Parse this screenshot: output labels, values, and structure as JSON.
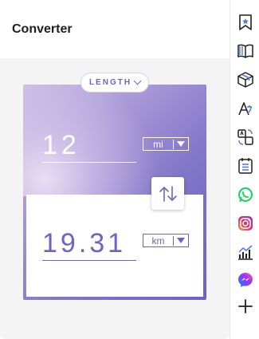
{
  "header": {
    "title": "Converter"
  },
  "category": {
    "label": "LENGTH"
  },
  "from": {
    "value": "12",
    "unit": "mi"
  },
  "to": {
    "value": "19.31",
    "unit": "km"
  },
  "colors": {
    "accent": "#6b64c3",
    "panel": "#f4f4f4",
    "whatsapp": "#25d366",
    "instagram": "#e1306c",
    "messenger": "#8a3ab9"
  },
  "sidebar": {
    "items": [
      {
        "icon": "bookmark-icon"
      },
      {
        "icon": "book-icon"
      },
      {
        "icon": "box-icon"
      },
      {
        "icon": "translate-icon"
      },
      {
        "icon": "converter-icon"
      },
      {
        "icon": "calendar-list-icon"
      },
      {
        "icon": "whatsapp-icon"
      },
      {
        "icon": "instagram-icon"
      },
      {
        "icon": "chart-icon"
      },
      {
        "icon": "messenger-icon"
      },
      {
        "icon": "add-icon"
      }
    ]
  }
}
